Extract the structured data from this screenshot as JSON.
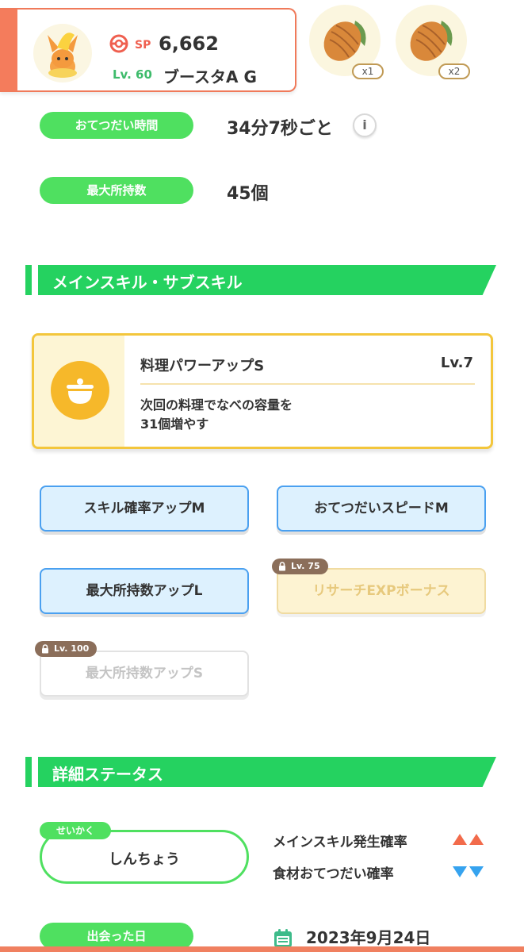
{
  "profile": {
    "sp_label": "SP",
    "sp_value": "6,662",
    "level": "Lv. 60",
    "name": "ブースタA G"
  },
  "items": [
    {
      "icon": "cacao-bean-icon",
      "count": "x1"
    },
    {
      "icon": "cacao-bean-icon",
      "count": "x2"
    }
  ],
  "info": {
    "help_time_label": "おてつだい時間",
    "help_time_value": "34分7秒ごと",
    "info_glyph": "i",
    "max_carry_label": "最大所持数",
    "max_carry_value": "45個"
  },
  "skills_section": {
    "title": "メインスキル・サブスキル"
  },
  "main_skill": {
    "name": "料理パワーアップS",
    "level": "Lv.7",
    "description": "次回の料理でなべの容量を\n31個増やす"
  },
  "sub_skills": [
    {
      "label": "スキル確率アップM",
      "state": "unlocked"
    },
    {
      "label": "おてつだいスピードM",
      "state": "unlocked"
    },
    {
      "label": "最大所持数アップL",
      "state": "unlocked"
    },
    {
      "label": "リサーチEXPボーナス",
      "state": "locked",
      "unlock_level": "Lv. 75"
    },
    {
      "label": "最大所持数アップS",
      "state": "locked",
      "unlock_level": "Lv. 100"
    }
  ],
  "status_section": {
    "title": "詳細ステータス"
  },
  "nature": {
    "tag": "せいかく",
    "value": "しんちょう",
    "up_label": "メインスキル発生確率",
    "down_label": "食材おてつだい確率",
    "up_color": "#f26b4b",
    "down_color": "#36a3ef"
  },
  "met_date": {
    "label": "出会った日",
    "value": "2023年9月24日"
  },
  "colors": {
    "green": "#25d260",
    "coral": "#f47c5c",
    "gold": "#f3c63c"
  }
}
